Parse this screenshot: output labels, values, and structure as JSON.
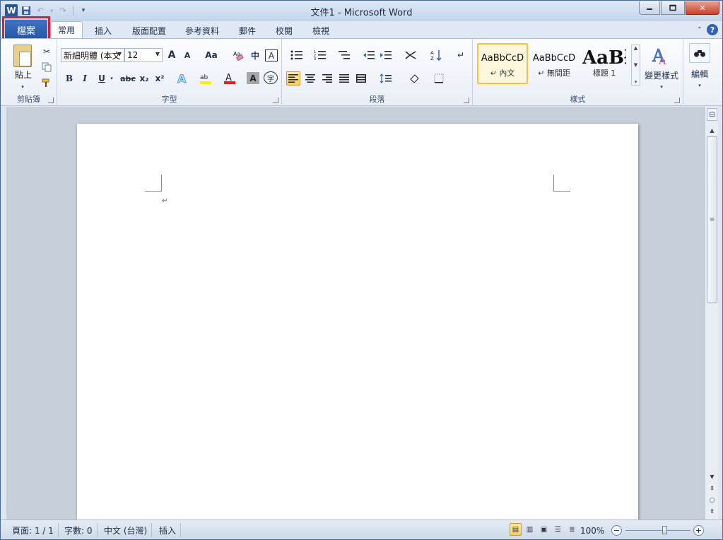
{
  "window": {
    "title": "文件1 - Microsoft Word"
  },
  "qat": {
    "logo": "W"
  },
  "tabs": [
    {
      "label": "檔案"
    },
    {
      "label": "常用"
    },
    {
      "label": "插入"
    },
    {
      "label": "版面配置"
    },
    {
      "label": "參考資料"
    },
    {
      "label": "郵件"
    },
    {
      "label": "校閱"
    },
    {
      "label": "檢視"
    }
  ],
  "ribbon": {
    "clipboard": {
      "label": "剪貼簿",
      "paste": "貼上"
    },
    "font": {
      "label": "字型",
      "font_name": "新細明體 (本文",
      "font_size": "12",
      "bold": "B",
      "italic": "I",
      "underline": "U",
      "strike": "abc",
      "subscript": "x₂",
      "superscript": "x²",
      "grow": "A",
      "shrink": "A",
      "change_case": "Aa",
      "phonetic": "中",
      "border_char": "A",
      "shading_char": "A",
      "enclose_char": "字"
    },
    "paragraph": {
      "label": "段落"
    },
    "styles": {
      "label": "樣式",
      "items": [
        {
          "sample": "AaBbCcD",
          "name": "↵ 內文"
        },
        {
          "sample": "AaBbCcD",
          "name": "↵ 無間距"
        },
        {
          "sample": "AaBł",
          "name": "標題 1"
        }
      ],
      "change_styles": "變更樣式"
    },
    "editing": {
      "label": "編輯"
    }
  },
  "document": {
    "paragraph_mark": "↵"
  },
  "status": {
    "page": "頁面: 1 / 1",
    "words": "字數: 0",
    "language": "中文 (台灣)",
    "mode": "插入",
    "zoom": "100%",
    "zoom_level": 100
  },
  "colors": {
    "file_tab": "#2b5ca8",
    "highlight": "#e8192c",
    "accent": "#f9cf5d"
  }
}
